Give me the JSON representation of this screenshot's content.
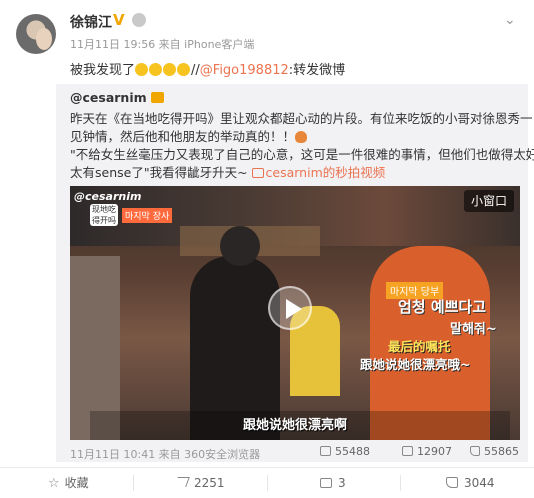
{
  "post": {
    "author": "徐锦江",
    "verified_badge": "V",
    "meta": "11月11日 19:56 来自 iPhone客户端",
    "text_before": "被我发现了",
    "text_mid": "//",
    "mention": "@Figo198812",
    "text_after": ":转发微博"
  },
  "repost": {
    "user": "@cesarnim",
    "line1": "昨天在《在当地吃得开吗》里让观众都超心动的片段。有位来吃饭的小哥对徐恩秀一",
    "line2": "见钟情，然后他和他朋友的举动真的！！",
    "line3": "\"不给女生丝毫压力又表现了自己的心意，这可是一件很难的事情，但他们也做得太好",
    "line4_text": "太有sense了\"我看得龇牙升天~ ",
    "video_link": "cesarnim的秒拍视频",
    "video": {
      "mini_window_label": "小窗口",
      "watermark": "@cesarnim",
      "wm_badge": "现地吃得开吗",
      "wm_tag": "마지막 장사",
      "kr_tag": "마지막 당부",
      "kr_line1": "엄청 예쁘다고",
      "kr_line2": "말해줘~",
      "zh_line1": "最后的嘱托",
      "zh_line2": "跟她说她很漂亮哦~",
      "subtitle": "跟她说她很漂亮啊"
    },
    "meta": "11月11日 10:41 来自 360安全浏览器",
    "shares": "55488",
    "comments": "12907",
    "likes": "55865"
  },
  "actions": {
    "favorite": "收藏",
    "share": "2251",
    "comment": "3",
    "like": "3044"
  },
  "icons": [
    "user-avatar-icon",
    "verified-icon",
    "vip-icon",
    "chevron-down-icon",
    "play-icon",
    "share-icon",
    "comment-icon",
    "like-icon",
    "star-icon"
  ],
  "colors": {
    "link": "#eb7350",
    "badge": "#f0a500",
    "repost_bg": "#f2f2f5"
  }
}
